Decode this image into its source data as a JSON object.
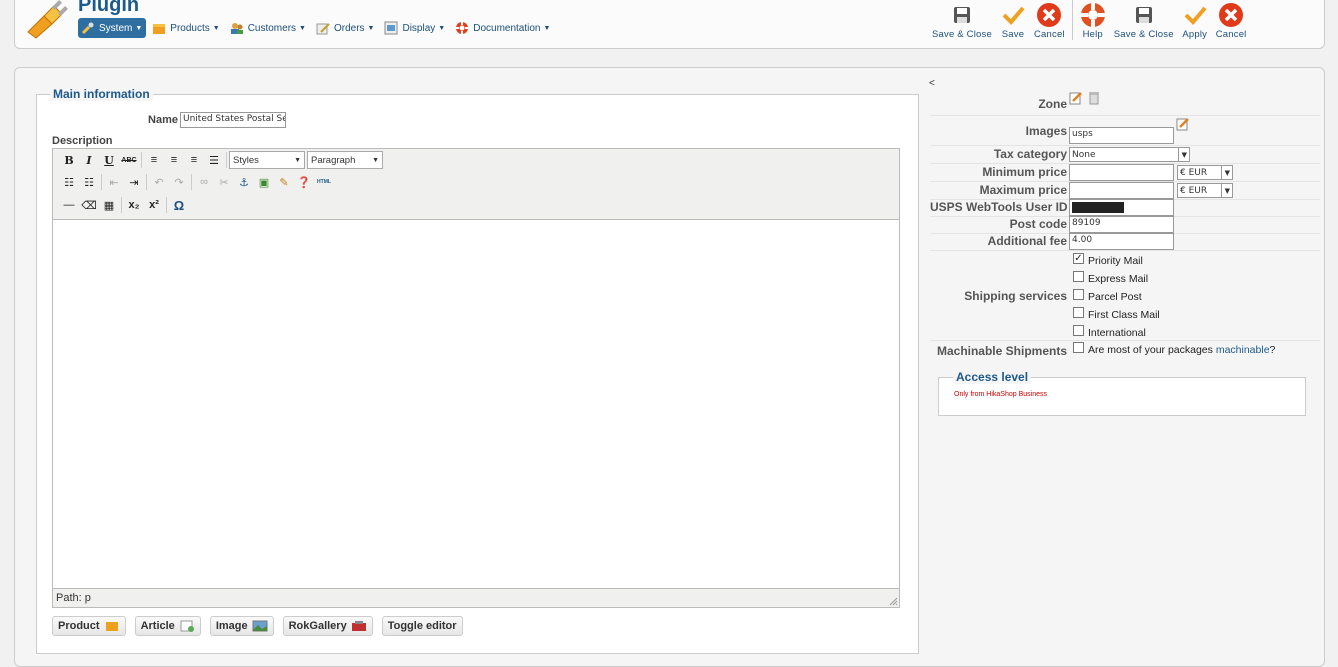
{
  "header": {
    "title": "Plugin",
    "menu": [
      {
        "label": "System",
        "icon": "wrench-icon",
        "active": true
      },
      {
        "label": "Products",
        "icon": "box-icon",
        "active": false
      },
      {
        "label": "Customers",
        "icon": "users-icon",
        "active": false
      },
      {
        "label": "Orders",
        "icon": "pen-icon",
        "active": false
      },
      {
        "label": "Display",
        "icon": "monitor-icon",
        "active": false
      },
      {
        "label": "Documentation",
        "icon": "lifebuoy-icon",
        "active": false
      }
    ],
    "toolbar_left": [
      {
        "label": "Save & Close",
        "icon": "save-icon"
      },
      {
        "label": "Save",
        "icon": "checkmark-icon"
      },
      {
        "label": "Cancel",
        "icon": "cancel-icon"
      }
    ],
    "toolbar_right": [
      {
        "label": "Help",
        "icon": "lifebuoy-icon"
      },
      {
        "label": "Save & Close",
        "icon": "save-icon"
      },
      {
        "label": "Apply",
        "icon": "checkmark-icon"
      },
      {
        "label": "Cancel",
        "icon": "cancel-icon"
      }
    ]
  },
  "main": {
    "legend": "Main information",
    "name_label": "Name",
    "name_value": "United States Postal Service",
    "description_label": "Description",
    "editor": {
      "styles_value": "Styles",
      "paragraph_value": "Paragraph",
      "path": "Path: p"
    },
    "buttons": [
      "Product",
      "Article",
      "Image",
      "RokGallery",
      "Toggle editor"
    ]
  },
  "params": {
    "collapse_char": "<",
    "zone_label": "Zone",
    "images_label": "Images",
    "images_value": "usps",
    "tax_label": "Tax category",
    "tax_value": "None",
    "min_price_label": "Minimum price",
    "min_price_value": "",
    "min_currency": "€ EUR",
    "max_price_label": "Maximum price",
    "max_price_value": "",
    "max_currency": "€ EUR",
    "userid_label": "USPS WebTools User ID",
    "postcode_label": "Post code",
    "postcode_value": "89109",
    "fee_label": "Additional fee",
    "fee_value": "4.00",
    "services_label": "Shipping services",
    "services": [
      {
        "label": "Priority Mail",
        "checked": true
      },
      {
        "label": "Express Mail",
        "checked": false
      },
      {
        "label": "Parcel Post",
        "checked": false
      },
      {
        "label": "First Class Mail",
        "checked": false
      },
      {
        "label": "International",
        "checked": false
      }
    ],
    "machinable_label": "Machinable Shipments",
    "machinable_text": "Are most of your packages",
    "machinable_link": "machinable",
    "machinable_suffix": "?",
    "access_legend": "Access level",
    "access_note": "Only from HikaShop Business"
  }
}
